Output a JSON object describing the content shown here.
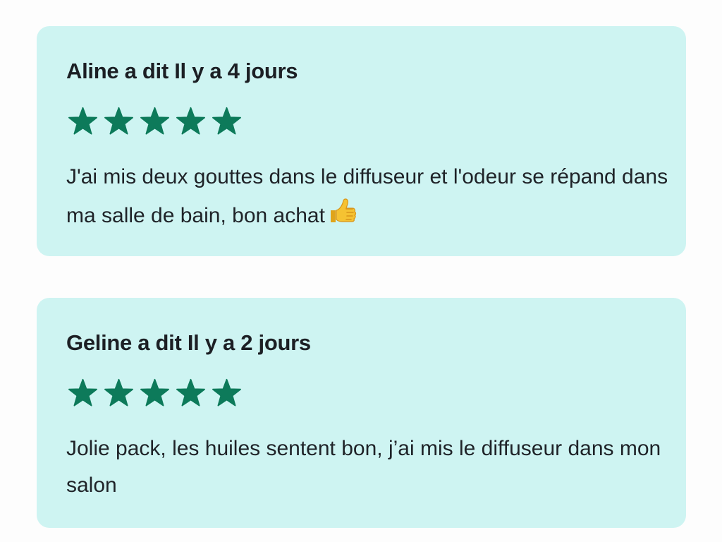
{
  "colors": {
    "card_background": "#cef4f2",
    "page_background": "#fdfdfd",
    "star": "#0d7a5a",
    "text": "#1f2328"
  },
  "reviews": [
    {
      "author": "Aline",
      "said": "a dit",
      "time": "Il y a 4 jours",
      "rating": 5,
      "rating_max": 5,
      "text": "J'ai mis deux gouttes dans le diffuseur et l'odeur se répand dans ma salle de bain, bon achat",
      "emoji_icon": "thumbs-up-icon"
    },
    {
      "author": "Geline",
      "said": "a dit",
      "time": "Il y a 2 jours",
      "rating": 5,
      "rating_max": 5,
      "text": "Jolie pack, les huiles sentent bon, j’ai mis le diffuseur dans mon salon"
    }
  ]
}
